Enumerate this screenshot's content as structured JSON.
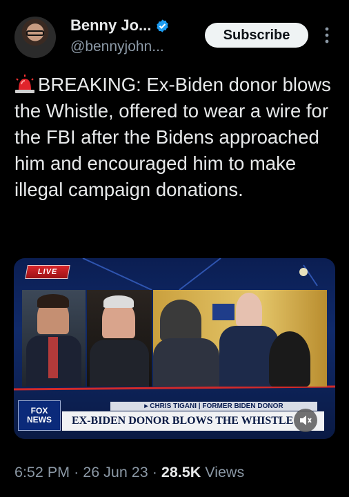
{
  "author": {
    "display_name": "Benny Jo...",
    "handle": "@bennyjohn..."
  },
  "actions": {
    "subscribe_label": "Subscribe"
  },
  "tweet": {
    "text": "BREAKING: Ex-Biden donor blows the Whistle, offered to wear a wire for the FBI after the Bidens approached him and encouraged him to make illegal campaign donations."
  },
  "media": {
    "live_badge": "LIVE",
    "lower_third_name": "▸ CHRIS TIGANI | FORMER BIDEN DONOR",
    "lower_third_headline": "EX-BIDEN DONOR BLOWS THE WHISTLE",
    "network_logo_line1": "FOX",
    "network_logo_line2": "NEWS"
  },
  "meta": {
    "time": "6:52 PM",
    "date": "26 Jun 23",
    "views_count": "28.5K",
    "views_label": "Views"
  },
  "colors": {
    "background": "#000000",
    "text": "#e7e9ea",
    "muted": "#8b98a5",
    "verified": "#1d9bf0"
  }
}
